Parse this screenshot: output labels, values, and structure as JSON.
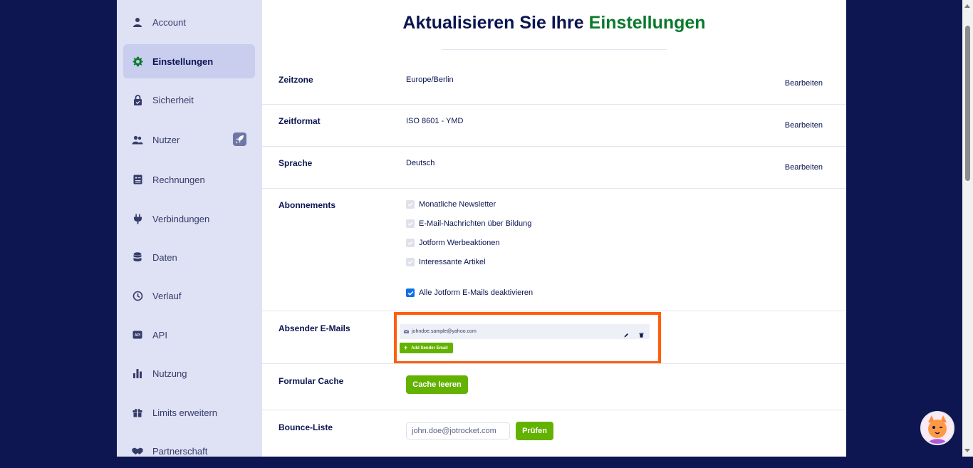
{
  "sidebar": {
    "items": [
      {
        "label": "Account",
        "icon": "user-icon"
      },
      {
        "label": "Einstellungen",
        "icon": "gear-icon"
      },
      {
        "label": "Sicherheit",
        "icon": "lock-icon"
      },
      {
        "label": "Nutzer",
        "icon": "users-icon"
      },
      {
        "label": "Rechnungen",
        "icon": "invoice-icon"
      },
      {
        "label": "Verbindungen",
        "icon": "plug-icon"
      },
      {
        "label": "Daten",
        "icon": "database-icon"
      },
      {
        "label": "Verlauf",
        "icon": "history-icon"
      },
      {
        "label": "API",
        "icon": "api-icon"
      },
      {
        "label": "Nutzung",
        "icon": "bar-chart-icon"
      },
      {
        "label": "Limits erweitern",
        "icon": "gift-icon"
      },
      {
        "label": "Partnerschaft",
        "icon": "handshake-icon"
      }
    ],
    "active": "Einstellungen"
  },
  "header": {
    "title_part1": "Aktualisieren Sie Ihre",
    "title_part2": "Einstellungen",
    "accent_color": "#0a7a2e"
  },
  "settings": {
    "zeitzone": {
      "label": "Zeitzone",
      "value": "Europe/Berlin",
      "action": "Bearbeiten"
    },
    "zeitformat": {
      "label": "Zeitformat",
      "value": "ISO 8601 - YMD",
      "action": "Bearbeiten"
    },
    "sprache": {
      "label": "Sprache",
      "value": "Deutsch",
      "action": "Bearbeiten"
    },
    "abonnements": {
      "label": "Abonnements",
      "options": [
        {
          "label": "Monatliche Newsletter",
          "checked": true,
          "disabled": true
        },
        {
          "label": "E-Mail-Nachrichten über Bildung",
          "checked": true,
          "disabled": true
        },
        {
          "label": "Jotform Werbeaktionen",
          "checked": true,
          "disabled": true
        },
        {
          "label": "Interessante Artikel",
          "checked": true,
          "disabled": true
        }
      ],
      "disable_all": {
        "label": "Alle Jotform E-Mails deaktivieren",
        "checked": true
      }
    },
    "absender": {
      "label": "Absender E-Mails",
      "email": "johndoe.sample@yahoo.com",
      "add_button": "Add Sender Email",
      "highlight_color": "#ff5e0e"
    },
    "cache": {
      "label": "Formular Cache",
      "button": "Cache leeren"
    },
    "bounce": {
      "label": "Bounce-Liste",
      "placeholder": "john.doe@jotrocket.com",
      "button": "Prüfen"
    }
  },
  "colors": {
    "background": "#0d1651",
    "sidebar": "#dfe1f4",
    "primary_green": "#64b200",
    "navy": "#0a1551"
  }
}
